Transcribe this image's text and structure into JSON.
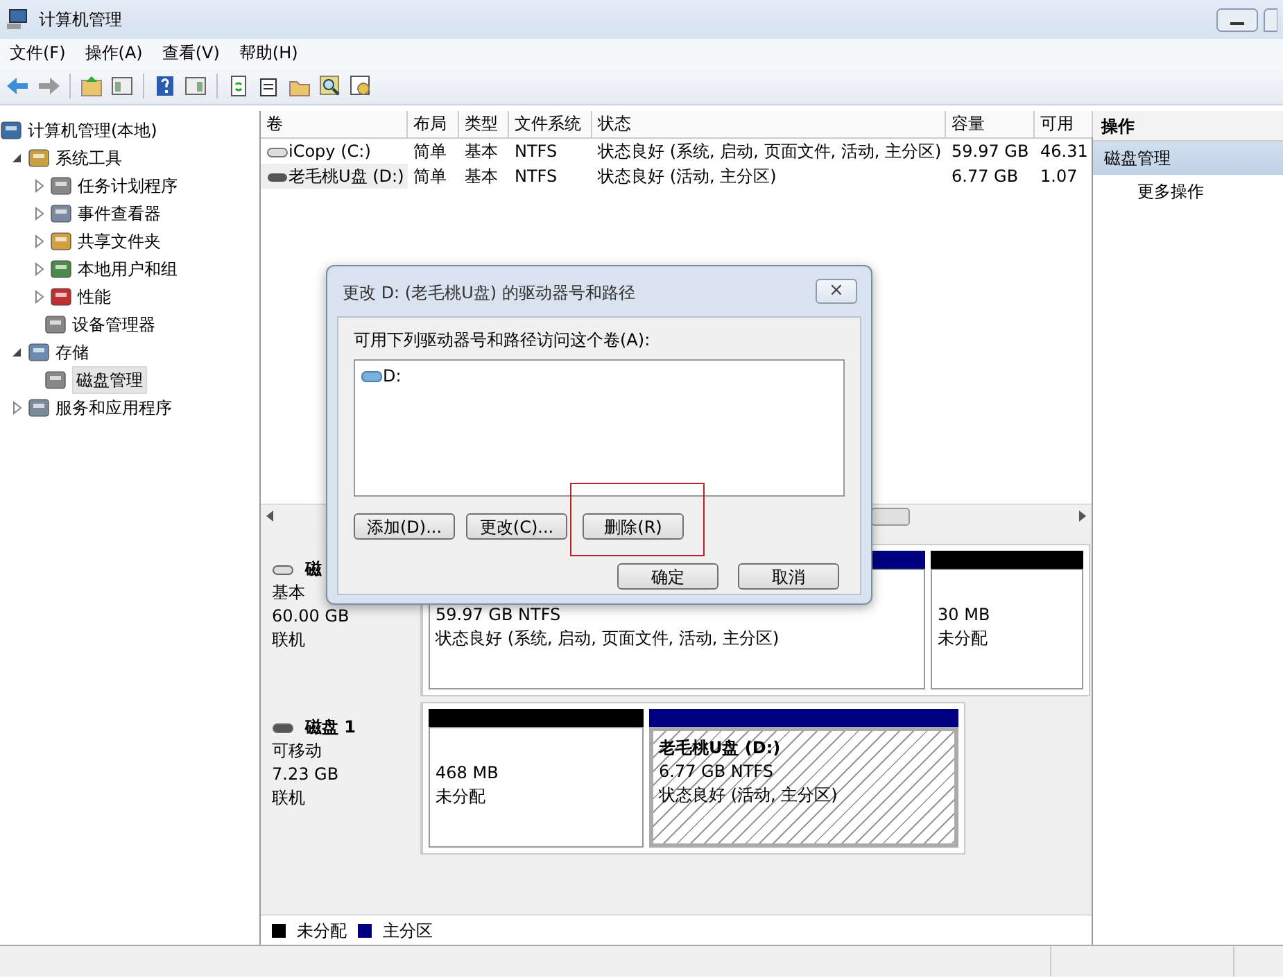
{
  "window": {
    "title": "计算机管理"
  },
  "menu": [
    "文件(F)",
    "操作(A)",
    "查看(V)",
    "帮助(H)"
  ],
  "tree": [
    {
      "label": "计算机管理(本地)",
      "selected": false,
      "children": [
        {
          "label": "系统工具",
          "expanded": true,
          "selected": false,
          "children": [
            {
              "label": "任务计划程序",
              "expanded": false,
              "selected": false
            },
            {
              "label": "事件查看器",
              "expanded": false,
              "selected": false
            },
            {
              "label": "共享文件夹",
              "expanded": false,
              "selected": false
            },
            {
              "label": "本地用户和组",
              "expanded": false,
              "selected": false
            },
            {
              "label": "性能",
              "expanded": false,
              "selected": false
            },
            {
              "label": "设备管理器",
              "selected": false
            }
          ]
        },
        {
          "label": "存储",
          "expanded": true,
          "selected": false,
          "children": [
            {
              "label": "磁盘管理",
              "selected": true
            }
          ]
        },
        {
          "label": "服务和应用程序",
          "expanded": false,
          "selected": false
        }
      ]
    }
  ],
  "volumes": {
    "columns": [
      "卷",
      "布局",
      "类型",
      "文件系统",
      "状态",
      "容量",
      "可用"
    ],
    "rows": [
      {
        "selected": false,
        "cells": [
          "iCopy (C:)",
          "简单",
          "基本",
          "NTFS",
          "状态良好 (系统, 启动, 页面文件, 活动, 主分区)",
          "59.97 GB",
          "46.31"
        ]
      },
      {
        "selected": true,
        "cells": [
          "老毛桃U盘 (D:)",
          "简单",
          "基本",
          "NTFS",
          "状态良好 (活动, 主分区)",
          "6.77 GB",
          "1.07"
        ]
      }
    ]
  },
  "disks": [
    {
      "name": "磁",
      "type": "基本",
      "size": "60.00 GB",
      "status": "联机",
      "partitions": [
        {
          "kind": "primary",
          "selected": false,
          "size": "59.97 GB NTFS",
          "status": "状态良好 (系统, 启动, 页面文件, 活动, 主分区)"
        },
        {
          "kind": "unallocated",
          "selected": false,
          "size": "30 MB",
          "status": "未分配"
        }
      ]
    },
    {
      "name": "磁盘 1",
      "type": "可移动",
      "size": "7.23 GB",
      "status": "联机",
      "partitions": [
        {
          "kind": "unallocated",
          "selected": false,
          "size": "468 MB",
          "status": "未分配"
        },
        {
          "kind": "primary",
          "selected": true,
          "name": "老毛桃U盘  (D:)",
          "size": "6.77 GB NTFS",
          "status": "状态良好 (活动, 主分区)"
        }
      ]
    }
  ],
  "legend": [
    {
      "label": "未分配",
      "color": "#000000"
    },
    {
      "label": "主分区",
      "color": "#000080"
    }
  ],
  "actions": {
    "header": "操作",
    "section": "磁盘管理",
    "items": [
      "更多操作"
    ]
  },
  "dialog": {
    "title": "更改 D: (老毛桃U盘) 的驱动器号和路径",
    "prompt": "可用下列驱动器号和路径访问这个卷(A):",
    "entries": [
      "D:"
    ],
    "buttons": [
      {
        "label": "添加(D)...",
        "highlighted": false
      },
      {
        "label": "更改(C)...",
        "highlighted": false
      },
      {
        "label": "删除(R)",
        "highlighted": true
      }
    ],
    "footer_buttons": [
      "确定",
      "取消"
    ],
    "close": "×"
  }
}
